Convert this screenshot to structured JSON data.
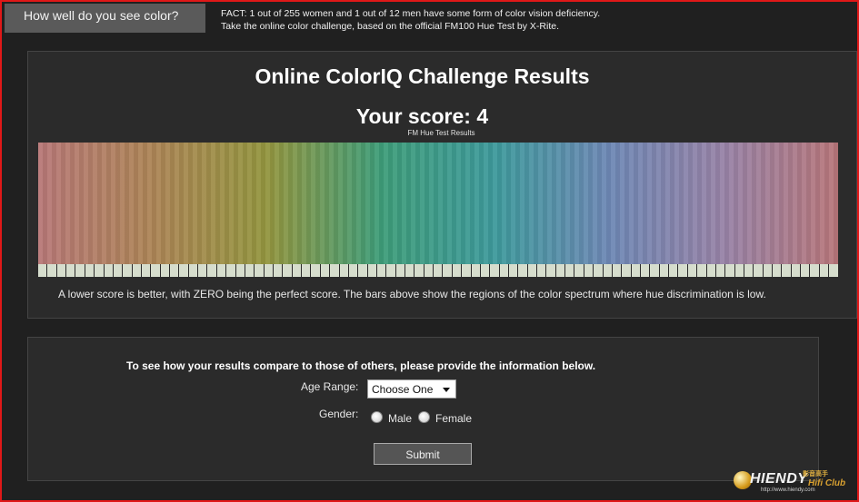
{
  "header": {
    "tab_label": "How well do you see color?",
    "fact_line1": "FACT: 1 out of 255 women and 1 out of 12 men have some form of color vision deficiency.",
    "fact_line2": "Take the online color challenge, based on the official FM100 Hue Test by X-Rite."
  },
  "results": {
    "title": "Online ColorIQ Challenge Results",
    "score_text": "Your score: 4",
    "spectrum_label": "FM Hue Test Results",
    "tick_count": 85,
    "spectrum_colors": [
      "#b87878",
      "#ad8556",
      "#94963f",
      "#3e9d79",
      "#3e9a9c",
      "#6e88b5",
      "#9883a7",
      "#b8767a"
    ],
    "note": "A lower score is better, with ZERO being the perfect score. The bars above show the regions of the color spectrum where hue discrimination is low."
  },
  "form": {
    "prompt": "To see how your results compare to those of others, please provide the information below.",
    "age_label": "Age Range:",
    "age_selected": "Choose One",
    "gender_label": "Gender:",
    "male_label": "Male",
    "female_label": "Female",
    "submit_label": "Submit"
  },
  "watermark": {
    "brand": "HIENDY",
    "sub": "影音高手",
    "club": "Hifi Club",
    "url": "http://www.hiendy.com"
  }
}
